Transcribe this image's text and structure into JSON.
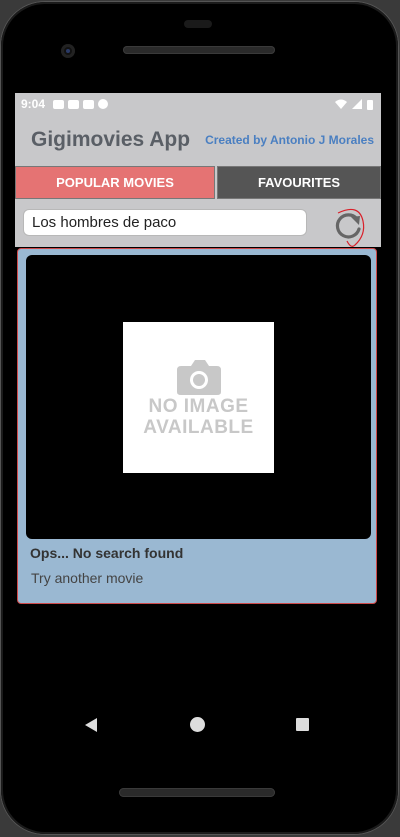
{
  "status_bar": {
    "time": "9:04",
    "left_icons": [
      "youtube-icon",
      "a-icon",
      "mail-icon",
      "sync-icon"
    ],
    "right_icons": [
      "wifi-icon",
      "signal-icon",
      "battery-icon"
    ]
  },
  "app_bar": {
    "title": "Gigimovies App",
    "credit": "Created by Antonio J Morales"
  },
  "tabs": [
    {
      "label": "POPULAR MOVIES",
      "active": true
    },
    {
      "label": "FAVOURITES",
      "active": false
    }
  ],
  "search": {
    "value": "Los hombres de paco",
    "refresh_icon": "refresh-icon"
  },
  "result_card": {
    "no_image_line1": "NO IMAGE",
    "no_image_line2": "AVAILABLE",
    "title": "Ops... No search found",
    "subtitle": "Try another movie"
  },
  "nav": [
    "back-icon",
    "home-icon",
    "recents-icon"
  ],
  "colors": {
    "active_tab": "#e57373",
    "inactive_tab": "#555555",
    "app_background": "#c8c8ca",
    "card_background": "#9ab8d2",
    "credit_text": "#4a7fc1"
  }
}
